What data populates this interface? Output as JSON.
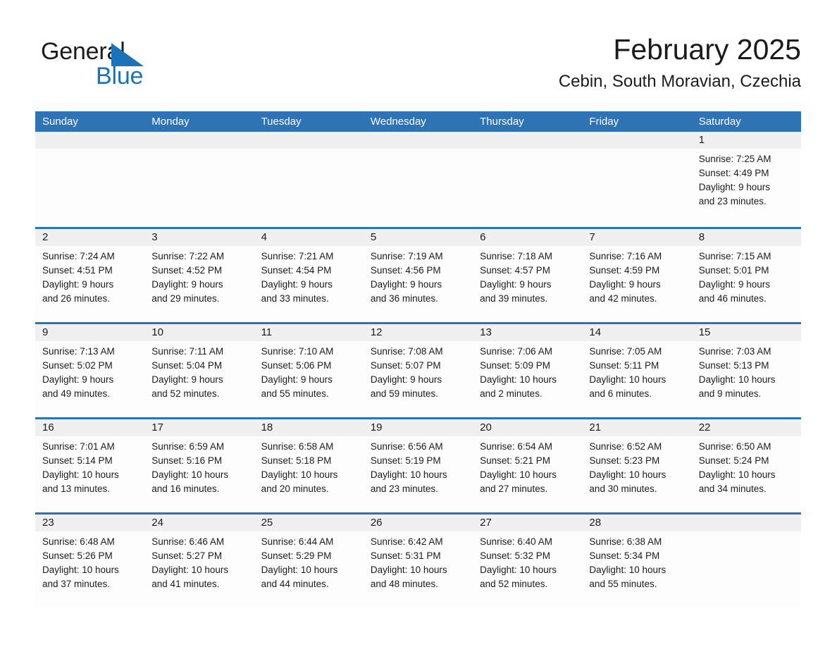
{
  "brand": {
    "name_part1": "General",
    "name_part2": "Blue",
    "logo_icon": "triangle-logo-icon",
    "accent_color": "#1b72b8"
  },
  "header": {
    "title": "February 2025",
    "location": "Cebin, South Moravian, Czechia"
  },
  "calendar": {
    "header_color": "#2e74b5",
    "day_strip_color": "#f0f0f0",
    "weekdays": [
      "Sunday",
      "Monday",
      "Tuesday",
      "Wednesday",
      "Thursday",
      "Friday",
      "Saturday"
    ],
    "weeks": [
      [
        {
          "day": "",
          "sunrise": "",
          "sunset": "",
          "daylight": "",
          "daylight2": ""
        },
        {
          "day": "",
          "sunrise": "",
          "sunset": "",
          "daylight": "",
          "daylight2": ""
        },
        {
          "day": "",
          "sunrise": "",
          "sunset": "",
          "daylight": "",
          "daylight2": ""
        },
        {
          "day": "",
          "sunrise": "",
          "sunset": "",
          "daylight": "",
          "daylight2": ""
        },
        {
          "day": "",
          "sunrise": "",
          "sunset": "",
          "daylight": "",
          "daylight2": ""
        },
        {
          "day": "",
          "sunrise": "",
          "sunset": "",
          "daylight": "",
          "daylight2": ""
        },
        {
          "day": "1",
          "sunrise": "Sunrise: 7:25 AM",
          "sunset": "Sunset: 4:49 PM",
          "daylight": "Daylight: 9 hours",
          "daylight2": "and 23 minutes."
        }
      ],
      [
        {
          "day": "2",
          "sunrise": "Sunrise: 7:24 AM",
          "sunset": "Sunset: 4:51 PM",
          "daylight": "Daylight: 9 hours",
          "daylight2": "and 26 minutes."
        },
        {
          "day": "3",
          "sunrise": "Sunrise: 7:22 AM",
          "sunset": "Sunset: 4:52 PM",
          "daylight": "Daylight: 9 hours",
          "daylight2": "and 29 minutes."
        },
        {
          "day": "4",
          "sunrise": "Sunrise: 7:21 AM",
          "sunset": "Sunset: 4:54 PM",
          "daylight": "Daylight: 9 hours",
          "daylight2": "and 33 minutes."
        },
        {
          "day": "5",
          "sunrise": "Sunrise: 7:19 AM",
          "sunset": "Sunset: 4:56 PM",
          "daylight": "Daylight: 9 hours",
          "daylight2": "and 36 minutes."
        },
        {
          "day": "6",
          "sunrise": "Sunrise: 7:18 AM",
          "sunset": "Sunset: 4:57 PM",
          "daylight": "Daylight: 9 hours",
          "daylight2": "and 39 minutes."
        },
        {
          "day": "7",
          "sunrise": "Sunrise: 7:16 AM",
          "sunset": "Sunset: 4:59 PM",
          "daylight": "Daylight: 9 hours",
          "daylight2": "and 42 minutes."
        },
        {
          "day": "8",
          "sunrise": "Sunrise: 7:15 AM",
          "sunset": "Sunset: 5:01 PM",
          "daylight": "Daylight: 9 hours",
          "daylight2": "and 46 minutes."
        }
      ],
      [
        {
          "day": "9",
          "sunrise": "Sunrise: 7:13 AM",
          "sunset": "Sunset: 5:02 PM",
          "daylight": "Daylight: 9 hours",
          "daylight2": "and 49 minutes."
        },
        {
          "day": "10",
          "sunrise": "Sunrise: 7:11 AM",
          "sunset": "Sunset: 5:04 PM",
          "daylight": "Daylight: 9 hours",
          "daylight2": "and 52 minutes."
        },
        {
          "day": "11",
          "sunrise": "Sunrise: 7:10 AM",
          "sunset": "Sunset: 5:06 PM",
          "daylight": "Daylight: 9 hours",
          "daylight2": "and 55 minutes."
        },
        {
          "day": "12",
          "sunrise": "Sunrise: 7:08 AM",
          "sunset": "Sunset: 5:07 PM",
          "daylight": "Daylight: 9 hours",
          "daylight2": "and 59 minutes."
        },
        {
          "day": "13",
          "sunrise": "Sunrise: 7:06 AM",
          "sunset": "Sunset: 5:09 PM",
          "daylight": "Daylight: 10 hours",
          "daylight2": "and 2 minutes."
        },
        {
          "day": "14",
          "sunrise": "Sunrise: 7:05 AM",
          "sunset": "Sunset: 5:11 PM",
          "daylight": "Daylight: 10 hours",
          "daylight2": "and 6 minutes."
        },
        {
          "day": "15",
          "sunrise": "Sunrise: 7:03 AM",
          "sunset": "Sunset: 5:13 PM",
          "daylight": "Daylight: 10 hours",
          "daylight2": "and 9 minutes."
        }
      ],
      [
        {
          "day": "16",
          "sunrise": "Sunrise: 7:01 AM",
          "sunset": "Sunset: 5:14 PM",
          "daylight": "Daylight: 10 hours",
          "daylight2": "and 13 minutes."
        },
        {
          "day": "17",
          "sunrise": "Sunrise: 6:59 AM",
          "sunset": "Sunset: 5:16 PM",
          "daylight": "Daylight: 10 hours",
          "daylight2": "and 16 minutes."
        },
        {
          "day": "18",
          "sunrise": "Sunrise: 6:58 AM",
          "sunset": "Sunset: 5:18 PM",
          "daylight": "Daylight: 10 hours",
          "daylight2": "and 20 minutes."
        },
        {
          "day": "19",
          "sunrise": "Sunrise: 6:56 AM",
          "sunset": "Sunset: 5:19 PM",
          "daylight": "Daylight: 10 hours",
          "daylight2": "and 23 minutes."
        },
        {
          "day": "20",
          "sunrise": "Sunrise: 6:54 AM",
          "sunset": "Sunset: 5:21 PM",
          "daylight": "Daylight: 10 hours",
          "daylight2": "and 27 minutes."
        },
        {
          "day": "21",
          "sunrise": "Sunrise: 6:52 AM",
          "sunset": "Sunset: 5:23 PM",
          "daylight": "Daylight: 10 hours",
          "daylight2": "and 30 minutes."
        },
        {
          "day": "22",
          "sunrise": "Sunrise: 6:50 AM",
          "sunset": "Sunset: 5:24 PM",
          "daylight": "Daylight: 10 hours",
          "daylight2": "and 34 minutes."
        }
      ],
      [
        {
          "day": "23",
          "sunrise": "Sunrise: 6:48 AM",
          "sunset": "Sunset: 5:26 PM",
          "daylight": "Daylight: 10 hours",
          "daylight2": "and 37 minutes."
        },
        {
          "day": "24",
          "sunrise": "Sunrise: 6:46 AM",
          "sunset": "Sunset: 5:27 PM",
          "daylight": "Daylight: 10 hours",
          "daylight2": "and 41 minutes."
        },
        {
          "day": "25",
          "sunrise": "Sunrise: 6:44 AM",
          "sunset": "Sunset: 5:29 PM",
          "daylight": "Daylight: 10 hours",
          "daylight2": "and 44 minutes."
        },
        {
          "day": "26",
          "sunrise": "Sunrise: 6:42 AM",
          "sunset": "Sunset: 5:31 PM",
          "daylight": "Daylight: 10 hours",
          "daylight2": "and 48 minutes."
        },
        {
          "day": "27",
          "sunrise": "Sunrise: 6:40 AM",
          "sunset": "Sunset: 5:32 PM",
          "daylight": "Daylight: 10 hours",
          "daylight2": "and 52 minutes."
        },
        {
          "day": "28",
          "sunrise": "Sunrise: 6:38 AM",
          "sunset": "Sunset: 5:34 PM",
          "daylight": "Daylight: 10 hours",
          "daylight2": "and 55 minutes."
        },
        {
          "day": "",
          "sunrise": "",
          "sunset": "",
          "daylight": "",
          "daylight2": ""
        }
      ]
    ]
  }
}
